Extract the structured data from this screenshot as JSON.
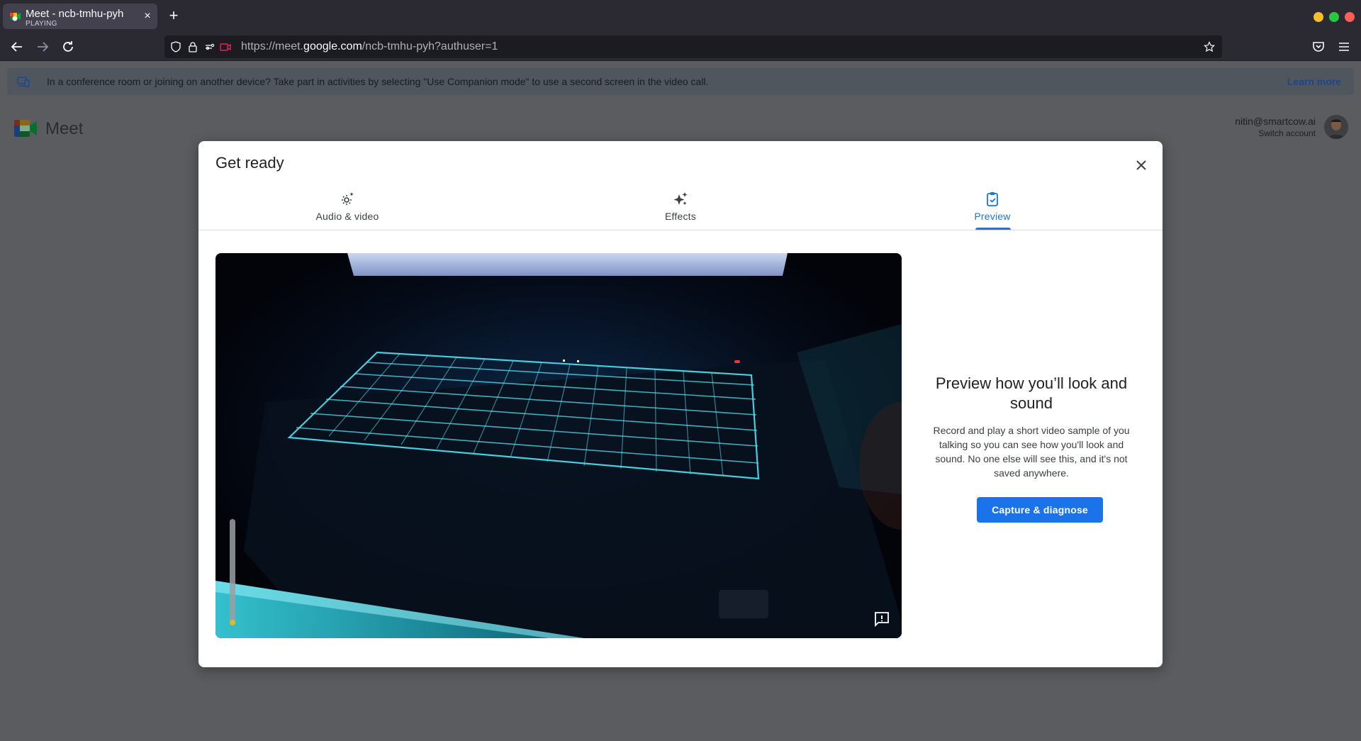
{
  "browser": {
    "tab": {
      "title": "Meet - ncb-tmhu-pyh",
      "status": "PLAYING"
    },
    "url": {
      "prefix": "https://meet.",
      "domain": "google.com",
      "path": "/ncb-tmhu-pyh?authuser=1"
    },
    "window_controls": {
      "minimize_color": "#f5bf2c",
      "maximize_color": "#27c840",
      "close_color": "#fe5f57"
    }
  },
  "banner": {
    "text": "In a conference room or joining on another device? Take part in activities by selecting \"Use Companion mode\" to use a second screen in the video call.",
    "link": "Learn more",
    "icon": "companion-device-icon"
  },
  "header": {
    "product": "Meet",
    "account_email": "nitin@smartcow.ai",
    "switch_account": "Switch account"
  },
  "dialog": {
    "title": "Get ready",
    "tabs": [
      {
        "label": "Audio & video",
        "icon": "settings-sparkle-icon",
        "active": false
      },
      {
        "label": "Effects",
        "icon": "sparkle-icon",
        "active": false
      },
      {
        "label": "Preview",
        "icon": "clipboard-check-icon",
        "active": true
      }
    ],
    "preview": {
      "title": "Preview how you’ll look and sound",
      "body": "Record and play a short video sample of you talking so you can see how you'll look and sound. No one else will see this, and it's not saved anywhere.",
      "button": "Capture & diagnose"
    },
    "mic_level": 0.05
  },
  "colors": {
    "accent": "#1a73e8",
    "mic_level": "#fbbc04"
  }
}
